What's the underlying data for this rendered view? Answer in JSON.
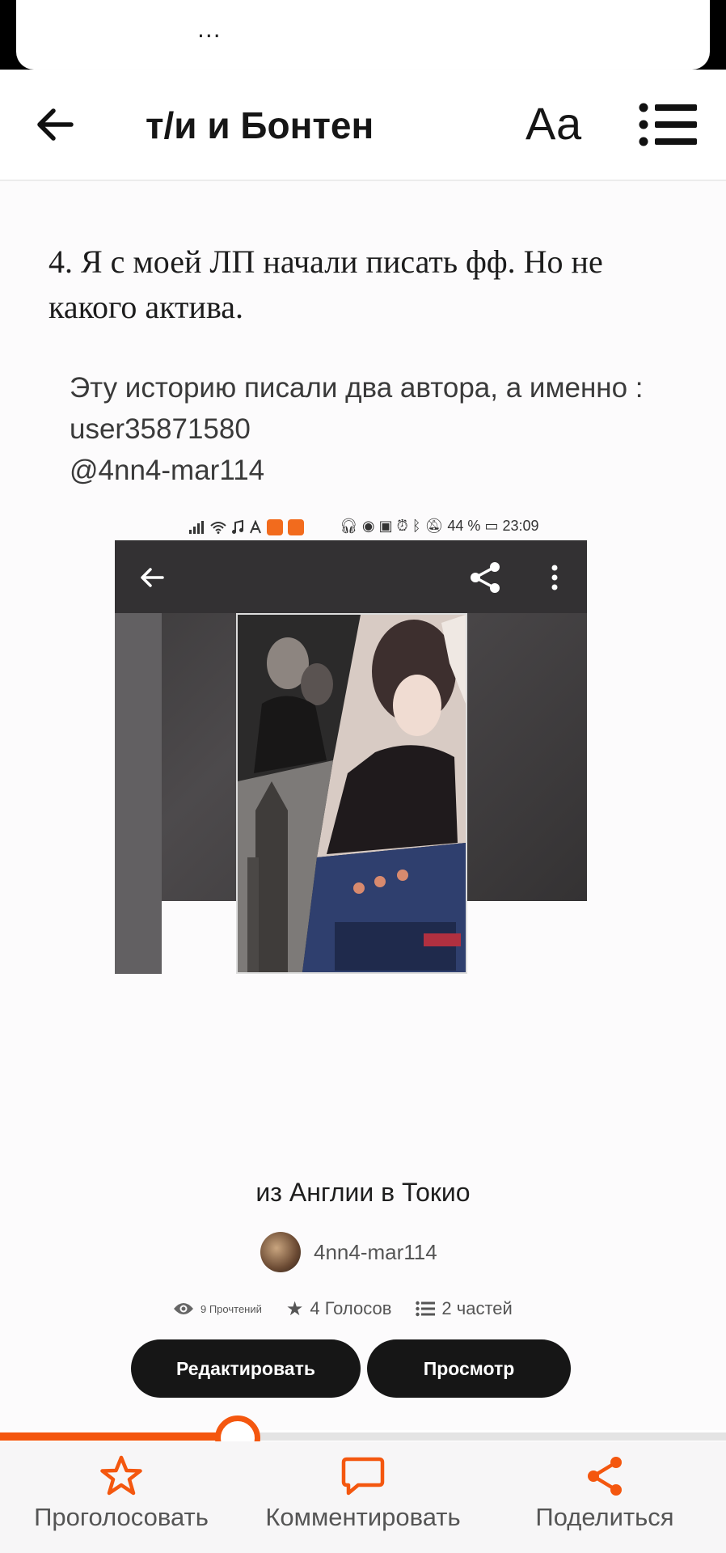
{
  "notification": {
    "dots": "..."
  },
  "header": {
    "title": "т/и и Бонтен",
    "font_size_label": "Аа"
  },
  "chapter": {
    "title": "4. Я с моей ЛП начали писать фф. Но не какого актива.",
    "note_lines": [
      "Эту историю писали два автора, а именно :",
      "user35871580",
      "@4nn4-mar114"
    ]
  },
  "embedded_screenshot": {
    "status": {
      "battery": "44 %",
      "time": "23:09"
    },
    "book_title": "из Англии в Токио",
    "author": "4nn4-mar114",
    "stats": {
      "reads": "9 Прочтений",
      "votes": "4 Голосов",
      "parts": "2 частей"
    },
    "buttons": {
      "edit": "Редактировать",
      "view": "Просмотр"
    }
  },
  "reading_progress": {
    "fraction": 0.327
  },
  "bottom_bar": {
    "vote": "Проголосовать",
    "comment": "Комментировать",
    "share": "Поделиться"
  },
  "colors": {
    "accent": "#f4570f",
    "button_dark": "#161616"
  }
}
